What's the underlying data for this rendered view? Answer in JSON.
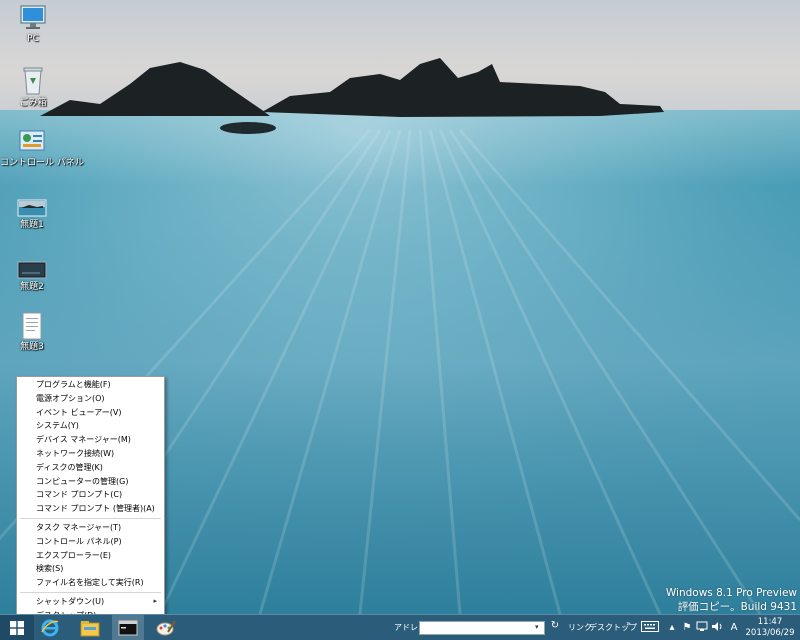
{
  "desktop": {
    "icons": [
      {
        "label": "PC",
        "icon": "computer-icon"
      },
      {
        "label": "ごみ箱",
        "icon": "recycle-bin-icon"
      },
      {
        "label": "コントロール パネル",
        "icon": "control-panel-icon"
      },
      {
        "label": "無題1",
        "icon": "image-file-icon"
      },
      {
        "label": "無題2",
        "icon": "image-file-icon"
      },
      {
        "label": "無題3",
        "icon": "text-file-icon"
      }
    ]
  },
  "context_menu": {
    "groups": [
      [
        "プログラムと機能(F)",
        "電源オプション(O)",
        "イベント ビューアー(V)",
        "システム(Y)",
        "デバイス マネージャー(M)",
        "ネットワーク接続(W)",
        "ディスクの管理(K)",
        "コンピューターの管理(G)",
        "コマンド プロンプト(C)",
        "コマンド プロンプト (管理者)(A)"
      ],
      [
        "タスク マネージャー(T)",
        "コントロール パネル(P)",
        "エクスプローラー(E)",
        "検索(S)",
        "ファイル名を指定して実行(R)"
      ],
      [
        "シャットダウン(U)",
        "デスクトップ(D)"
      ]
    ],
    "submenu_arrow": "▸"
  },
  "watermark": {
    "line1": "Windows 8.1 Pro Preview",
    "line2": "評価コピー。Build 9431"
  },
  "taskbar": {
    "address_label": "アドレス",
    "address_value": "",
    "links_label": "リンク",
    "desktop_label": "デスクトップ",
    "overflow": "»",
    "ime_mode": "A",
    "time": "11:47",
    "date": "2013/06/29",
    "apps": [
      "internet-explorer-icon",
      "file-explorer-icon",
      "command-prompt-icon",
      "paint-icon"
    ]
  },
  "colors": {
    "taskbar": "#2b5c7a",
    "start_button": "#1e4a66",
    "menu_bg": "#ffffff"
  }
}
